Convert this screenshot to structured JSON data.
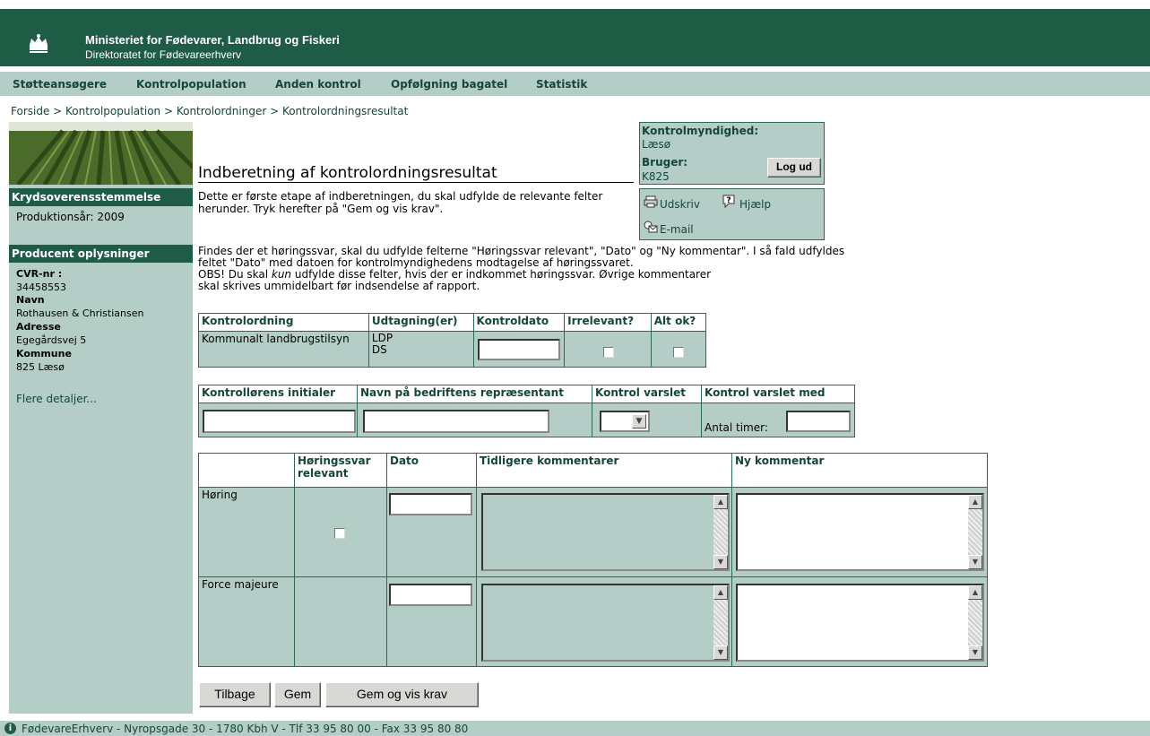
{
  "header": {
    "ministry": "Ministeriet for Fødevarer, Landbrug og Fiskeri",
    "directorate": "Direktoratet for Fødevareerhverv"
  },
  "nav": [
    "Støtteansøgere",
    "Kontrolpopulation",
    "Anden kontrol",
    "Opfølgning bagatel",
    "Statistik"
  ],
  "breadcrumb": "Forside > Kontrolpopulation > Kontrolordninger > Kontrolordningsresultat",
  "sidebar": {
    "section1_title": "Krydsoverensstemmelse",
    "production_year": "Produktionsår: 2009",
    "section2_title": "Producent oplysninger",
    "cvr_label": "CVR-nr :",
    "cvr_value": "34458553",
    "name_label": "Navn",
    "name_value": "Rothausen & Christiansen",
    "address_label": "Adresse",
    "address_value": "Egegårdsvej 5",
    "municipality_label": "Kommune",
    "municipality_value": "825 Læsø",
    "more_details": "Flere detaljer..."
  },
  "page_title": "Indberetning af kontrolordningsresultat",
  "user_box": {
    "authority_label": "Kontrolmyndighed:",
    "authority_value": "Læsø",
    "user_label": "Bruger:",
    "user_value": "K825",
    "logout": "Log ud"
  },
  "tools": {
    "print": "Udskriv",
    "help": "Hjælp",
    "email": "E-mail"
  },
  "intro": "Dette er første etape af indberetningen, du skal udfylde de relevante felter herunder. Tryk herefter på \"Gem og vis krav\".",
  "note_line1": "Findes der et høringssvar, skal du udfylde felterne \"Høringssvar relevant\", \"Dato\" og \"Ny kommentar\". I så fald udfyldes",
  "note_line2": "feltet \"Dato\" med datoen for kontrolmyndighedens modtagelse af høringssvaret.",
  "note_line3a": "OBS! Du skal ",
  "note_line3b": "kun",
  "note_line3c": " udfylde disse felter, hvis der er indkommet høringssvar. Øvrige kommentarer",
  "note_line4": "skal skrives ummidelbart før indsendelse af rapport.",
  "table1": {
    "headers": [
      "Kontrolordning",
      "Udtagning(er)",
      "Kontroldato",
      "Irrelevant?",
      "Alt ok?"
    ],
    "ordning": "Kommunalt landbrugstilsyn",
    "udtagning1": "LDP",
    "udtagning2": "DS"
  },
  "table2": {
    "headers": [
      "Kontrollørens initialer",
      "Navn på bedriftens repræsentant",
      "Kontrol varslet",
      "Kontrol varslet med"
    ],
    "hours_label": "Antal timer:"
  },
  "table3": {
    "headers": [
      "",
      "Høringssvar relevant",
      "Dato",
      "Tidligere kommentarer",
      "Ny kommentar"
    ],
    "rows": [
      "Høring",
      "Force majeure"
    ]
  },
  "buttons": {
    "back": "Tilbage",
    "save": "Gem",
    "save_show": "Gem og vis krav"
  },
  "footer": "FødevareErhverv - Nyropsgade 30 - 1780 Kbh V - Tlf 33 95 80 00 - Fax 33 95 80 80",
  "colors": {
    "dark_green": "#1f5c46",
    "light_green": "#b4cec7"
  }
}
